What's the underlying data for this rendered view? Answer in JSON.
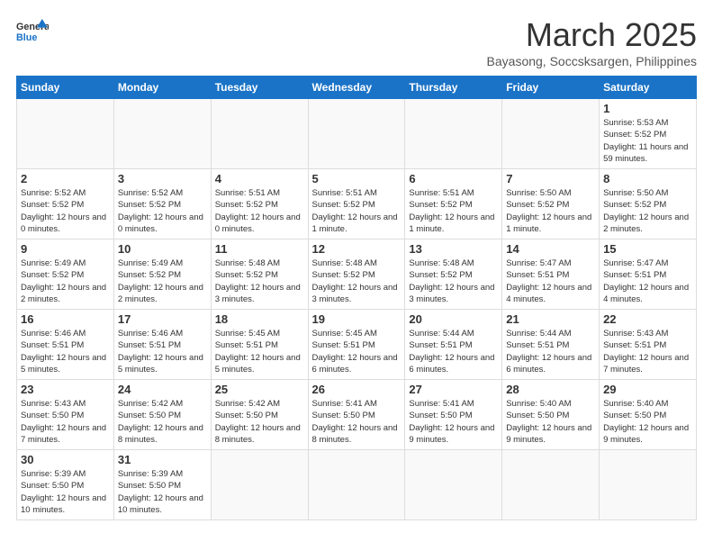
{
  "logo": {
    "line1": "General",
    "line2": "Blue"
  },
  "title": "March 2025",
  "location": "Bayasong, Soccsksargen, Philippines",
  "days_header": [
    "Sunday",
    "Monday",
    "Tuesday",
    "Wednesday",
    "Thursday",
    "Friday",
    "Saturday"
  ],
  "weeks": [
    [
      {
        "day": "",
        "info": ""
      },
      {
        "day": "",
        "info": ""
      },
      {
        "day": "",
        "info": ""
      },
      {
        "day": "",
        "info": ""
      },
      {
        "day": "",
        "info": ""
      },
      {
        "day": "",
        "info": ""
      },
      {
        "day": "1",
        "info": "Sunrise: 5:53 AM\nSunset: 5:52 PM\nDaylight: 11 hours and 59 minutes."
      }
    ],
    [
      {
        "day": "2",
        "info": "Sunrise: 5:52 AM\nSunset: 5:52 PM\nDaylight: 12 hours and 0 minutes."
      },
      {
        "day": "3",
        "info": "Sunrise: 5:52 AM\nSunset: 5:52 PM\nDaylight: 12 hours and 0 minutes."
      },
      {
        "day": "4",
        "info": "Sunrise: 5:51 AM\nSunset: 5:52 PM\nDaylight: 12 hours and 0 minutes."
      },
      {
        "day": "5",
        "info": "Sunrise: 5:51 AM\nSunset: 5:52 PM\nDaylight: 12 hours and 1 minute."
      },
      {
        "day": "6",
        "info": "Sunrise: 5:51 AM\nSunset: 5:52 PM\nDaylight: 12 hours and 1 minute."
      },
      {
        "day": "7",
        "info": "Sunrise: 5:50 AM\nSunset: 5:52 PM\nDaylight: 12 hours and 1 minute."
      },
      {
        "day": "8",
        "info": "Sunrise: 5:50 AM\nSunset: 5:52 PM\nDaylight: 12 hours and 2 minutes."
      }
    ],
    [
      {
        "day": "9",
        "info": "Sunrise: 5:49 AM\nSunset: 5:52 PM\nDaylight: 12 hours and 2 minutes."
      },
      {
        "day": "10",
        "info": "Sunrise: 5:49 AM\nSunset: 5:52 PM\nDaylight: 12 hours and 2 minutes."
      },
      {
        "day": "11",
        "info": "Sunrise: 5:48 AM\nSunset: 5:52 PM\nDaylight: 12 hours and 3 minutes."
      },
      {
        "day": "12",
        "info": "Sunrise: 5:48 AM\nSunset: 5:52 PM\nDaylight: 12 hours and 3 minutes."
      },
      {
        "day": "13",
        "info": "Sunrise: 5:48 AM\nSunset: 5:52 PM\nDaylight: 12 hours and 3 minutes."
      },
      {
        "day": "14",
        "info": "Sunrise: 5:47 AM\nSunset: 5:51 PM\nDaylight: 12 hours and 4 minutes."
      },
      {
        "day": "15",
        "info": "Sunrise: 5:47 AM\nSunset: 5:51 PM\nDaylight: 12 hours and 4 minutes."
      }
    ],
    [
      {
        "day": "16",
        "info": "Sunrise: 5:46 AM\nSunset: 5:51 PM\nDaylight: 12 hours and 5 minutes."
      },
      {
        "day": "17",
        "info": "Sunrise: 5:46 AM\nSunset: 5:51 PM\nDaylight: 12 hours and 5 minutes."
      },
      {
        "day": "18",
        "info": "Sunrise: 5:45 AM\nSunset: 5:51 PM\nDaylight: 12 hours and 5 minutes."
      },
      {
        "day": "19",
        "info": "Sunrise: 5:45 AM\nSunset: 5:51 PM\nDaylight: 12 hours and 6 minutes."
      },
      {
        "day": "20",
        "info": "Sunrise: 5:44 AM\nSunset: 5:51 PM\nDaylight: 12 hours and 6 minutes."
      },
      {
        "day": "21",
        "info": "Sunrise: 5:44 AM\nSunset: 5:51 PM\nDaylight: 12 hours and 6 minutes."
      },
      {
        "day": "22",
        "info": "Sunrise: 5:43 AM\nSunset: 5:51 PM\nDaylight: 12 hours and 7 minutes."
      }
    ],
    [
      {
        "day": "23",
        "info": "Sunrise: 5:43 AM\nSunset: 5:50 PM\nDaylight: 12 hours and 7 minutes."
      },
      {
        "day": "24",
        "info": "Sunrise: 5:42 AM\nSunset: 5:50 PM\nDaylight: 12 hours and 8 minutes."
      },
      {
        "day": "25",
        "info": "Sunrise: 5:42 AM\nSunset: 5:50 PM\nDaylight: 12 hours and 8 minutes."
      },
      {
        "day": "26",
        "info": "Sunrise: 5:41 AM\nSunset: 5:50 PM\nDaylight: 12 hours and 8 minutes."
      },
      {
        "day": "27",
        "info": "Sunrise: 5:41 AM\nSunset: 5:50 PM\nDaylight: 12 hours and 9 minutes."
      },
      {
        "day": "28",
        "info": "Sunrise: 5:40 AM\nSunset: 5:50 PM\nDaylight: 12 hours and 9 minutes."
      },
      {
        "day": "29",
        "info": "Sunrise: 5:40 AM\nSunset: 5:50 PM\nDaylight: 12 hours and 9 minutes."
      }
    ],
    [
      {
        "day": "30",
        "info": "Sunrise: 5:39 AM\nSunset: 5:50 PM\nDaylight: 12 hours and 10 minutes."
      },
      {
        "day": "31",
        "info": "Sunrise: 5:39 AM\nSunset: 5:50 PM\nDaylight: 12 hours and 10 minutes."
      },
      {
        "day": "",
        "info": ""
      },
      {
        "day": "",
        "info": ""
      },
      {
        "day": "",
        "info": ""
      },
      {
        "day": "",
        "info": ""
      },
      {
        "day": "",
        "info": ""
      }
    ]
  ]
}
